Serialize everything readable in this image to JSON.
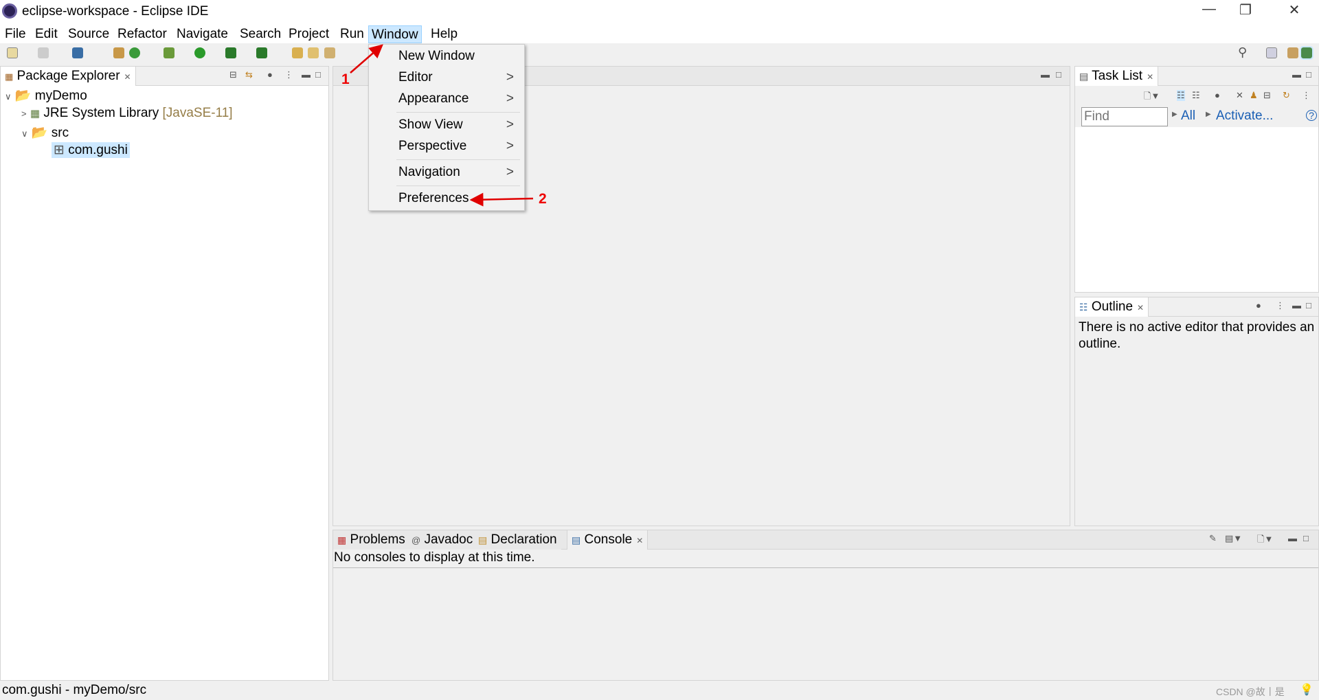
{
  "window": {
    "title": "eclipse-workspace - Eclipse IDE",
    "minimize_icon": "minimize-icon",
    "restore_icon": "restore-icon",
    "close_icon": "close-icon"
  },
  "menubar": [
    "File",
    "Edit",
    "Source",
    "Refactor",
    "Navigate",
    "Search",
    "Project",
    "Run",
    "Window",
    "Help"
  ],
  "window_menu": {
    "items": [
      "New Window",
      "Editor",
      "Appearance",
      "Show View",
      "Perspective",
      "Navigation",
      "Preferences"
    ],
    "submenu_indicator": ">"
  },
  "package_explorer": {
    "title": "Package Explorer",
    "project": "myDemo",
    "jre": "JRE System Library",
    "jre_version": "[JavaSE-11]",
    "src": "src",
    "package": "com.gushi"
  },
  "task_list": {
    "title": "Task List",
    "find_placeholder": "Find",
    "all": "All",
    "activate": "Activate..."
  },
  "outline": {
    "title": "Outline",
    "message": "There is no active editor that provides an outline."
  },
  "bottom": {
    "tabs": [
      "Problems",
      "Javadoc",
      "Declaration",
      "Console"
    ],
    "message": "No consoles to display at this time."
  },
  "status": {
    "text": "com.gushi - myDemo/src",
    "watermark": "CSDN @故丨是"
  },
  "annotations": {
    "step1": "1",
    "step2": "2",
    "color": "#e00000"
  },
  "colors": {
    "selection": "#cce8ff",
    "link": "#1a5fb4",
    "decoration": "#957d47"
  }
}
